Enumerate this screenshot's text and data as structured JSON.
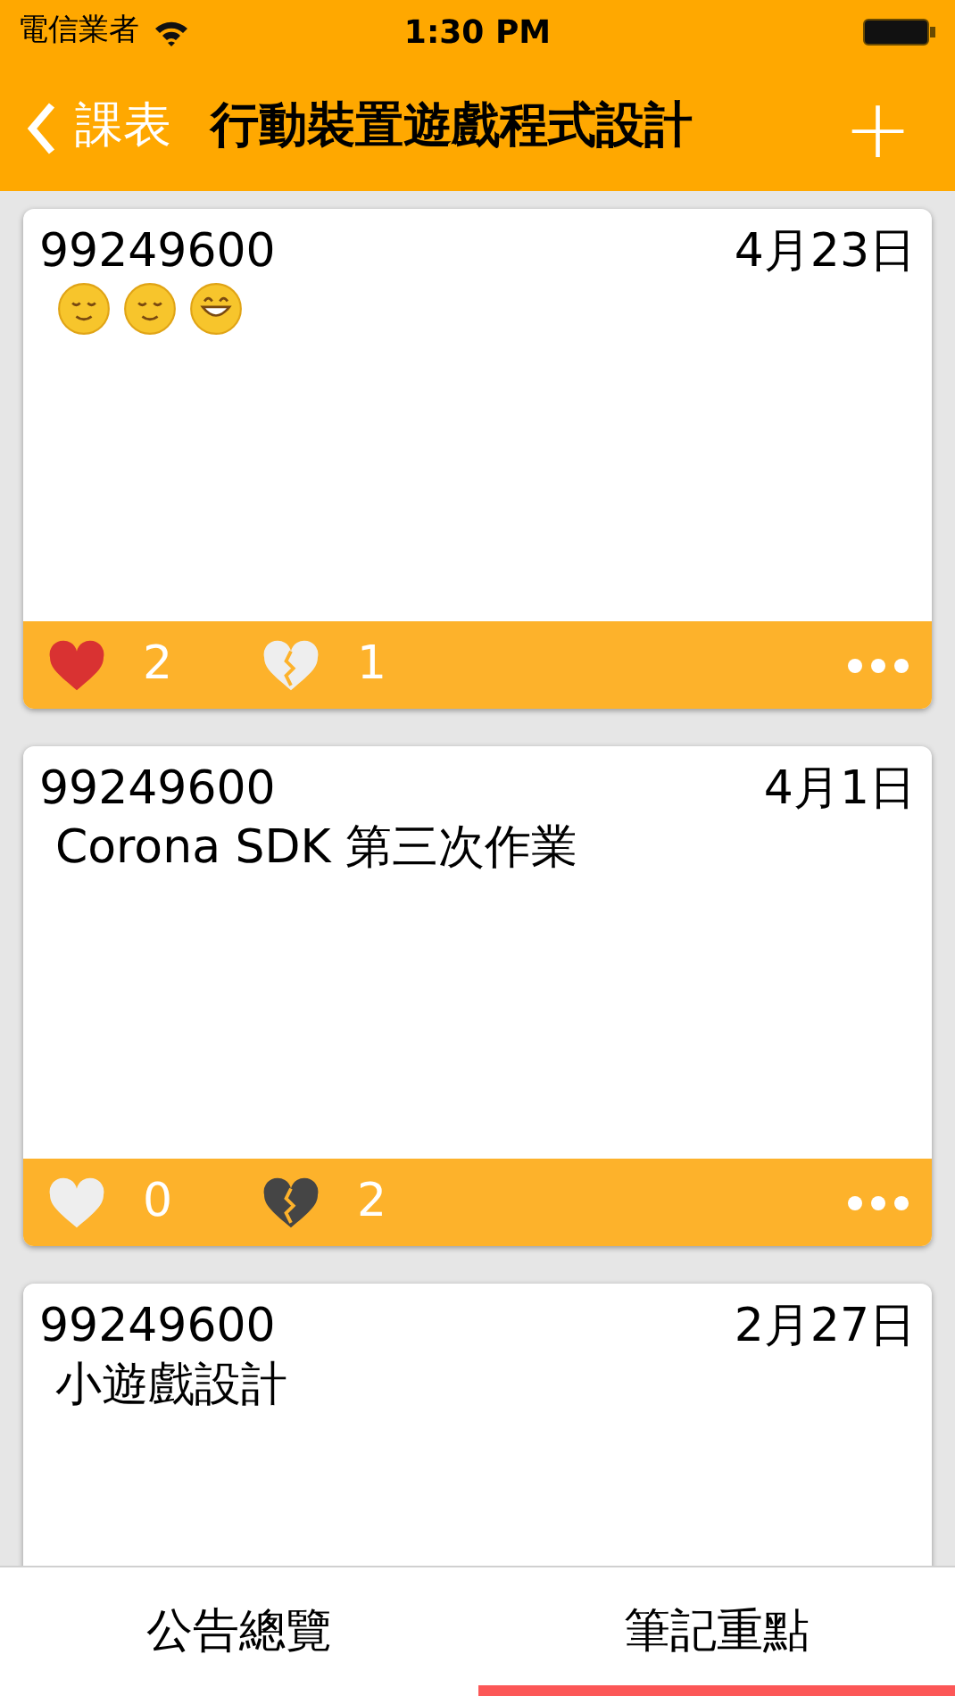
{
  "status_bar": {
    "carrier": "電信業者",
    "time": "1:30 PM"
  },
  "nav": {
    "back": "課表",
    "title": "行動裝置遊戲程式設計",
    "add": "+"
  },
  "notes": [
    {
      "author": "99249600",
      "date": "4月23日",
      "emojis": [
        {
          "kind": "relieved"
        },
        {
          "kind": "relieved"
        },
        {
          "kind": "grin"
        }
      ],
      "likes": "2",
      "liked": true,
      "dislikes": "1",
      "disliked": false
    },
    {
      "author": "99249600",
      "date": "4月1日",
      "body": "Corona SDK 第三次作業",
      "likes": "0",
      "liked": false,
      "dislikes": "2",
      "disliked": true
    },
    {
      "author": "99249600",
      "date": "2月27日",
      "body": "小遊戲設計"
    }
  ],
  "tabs": [
    {
      "label": "公告總覽",
      "selected": false
    },
    {
      "label": "筆記重點",
      "selected": true
    }
  ]
}
